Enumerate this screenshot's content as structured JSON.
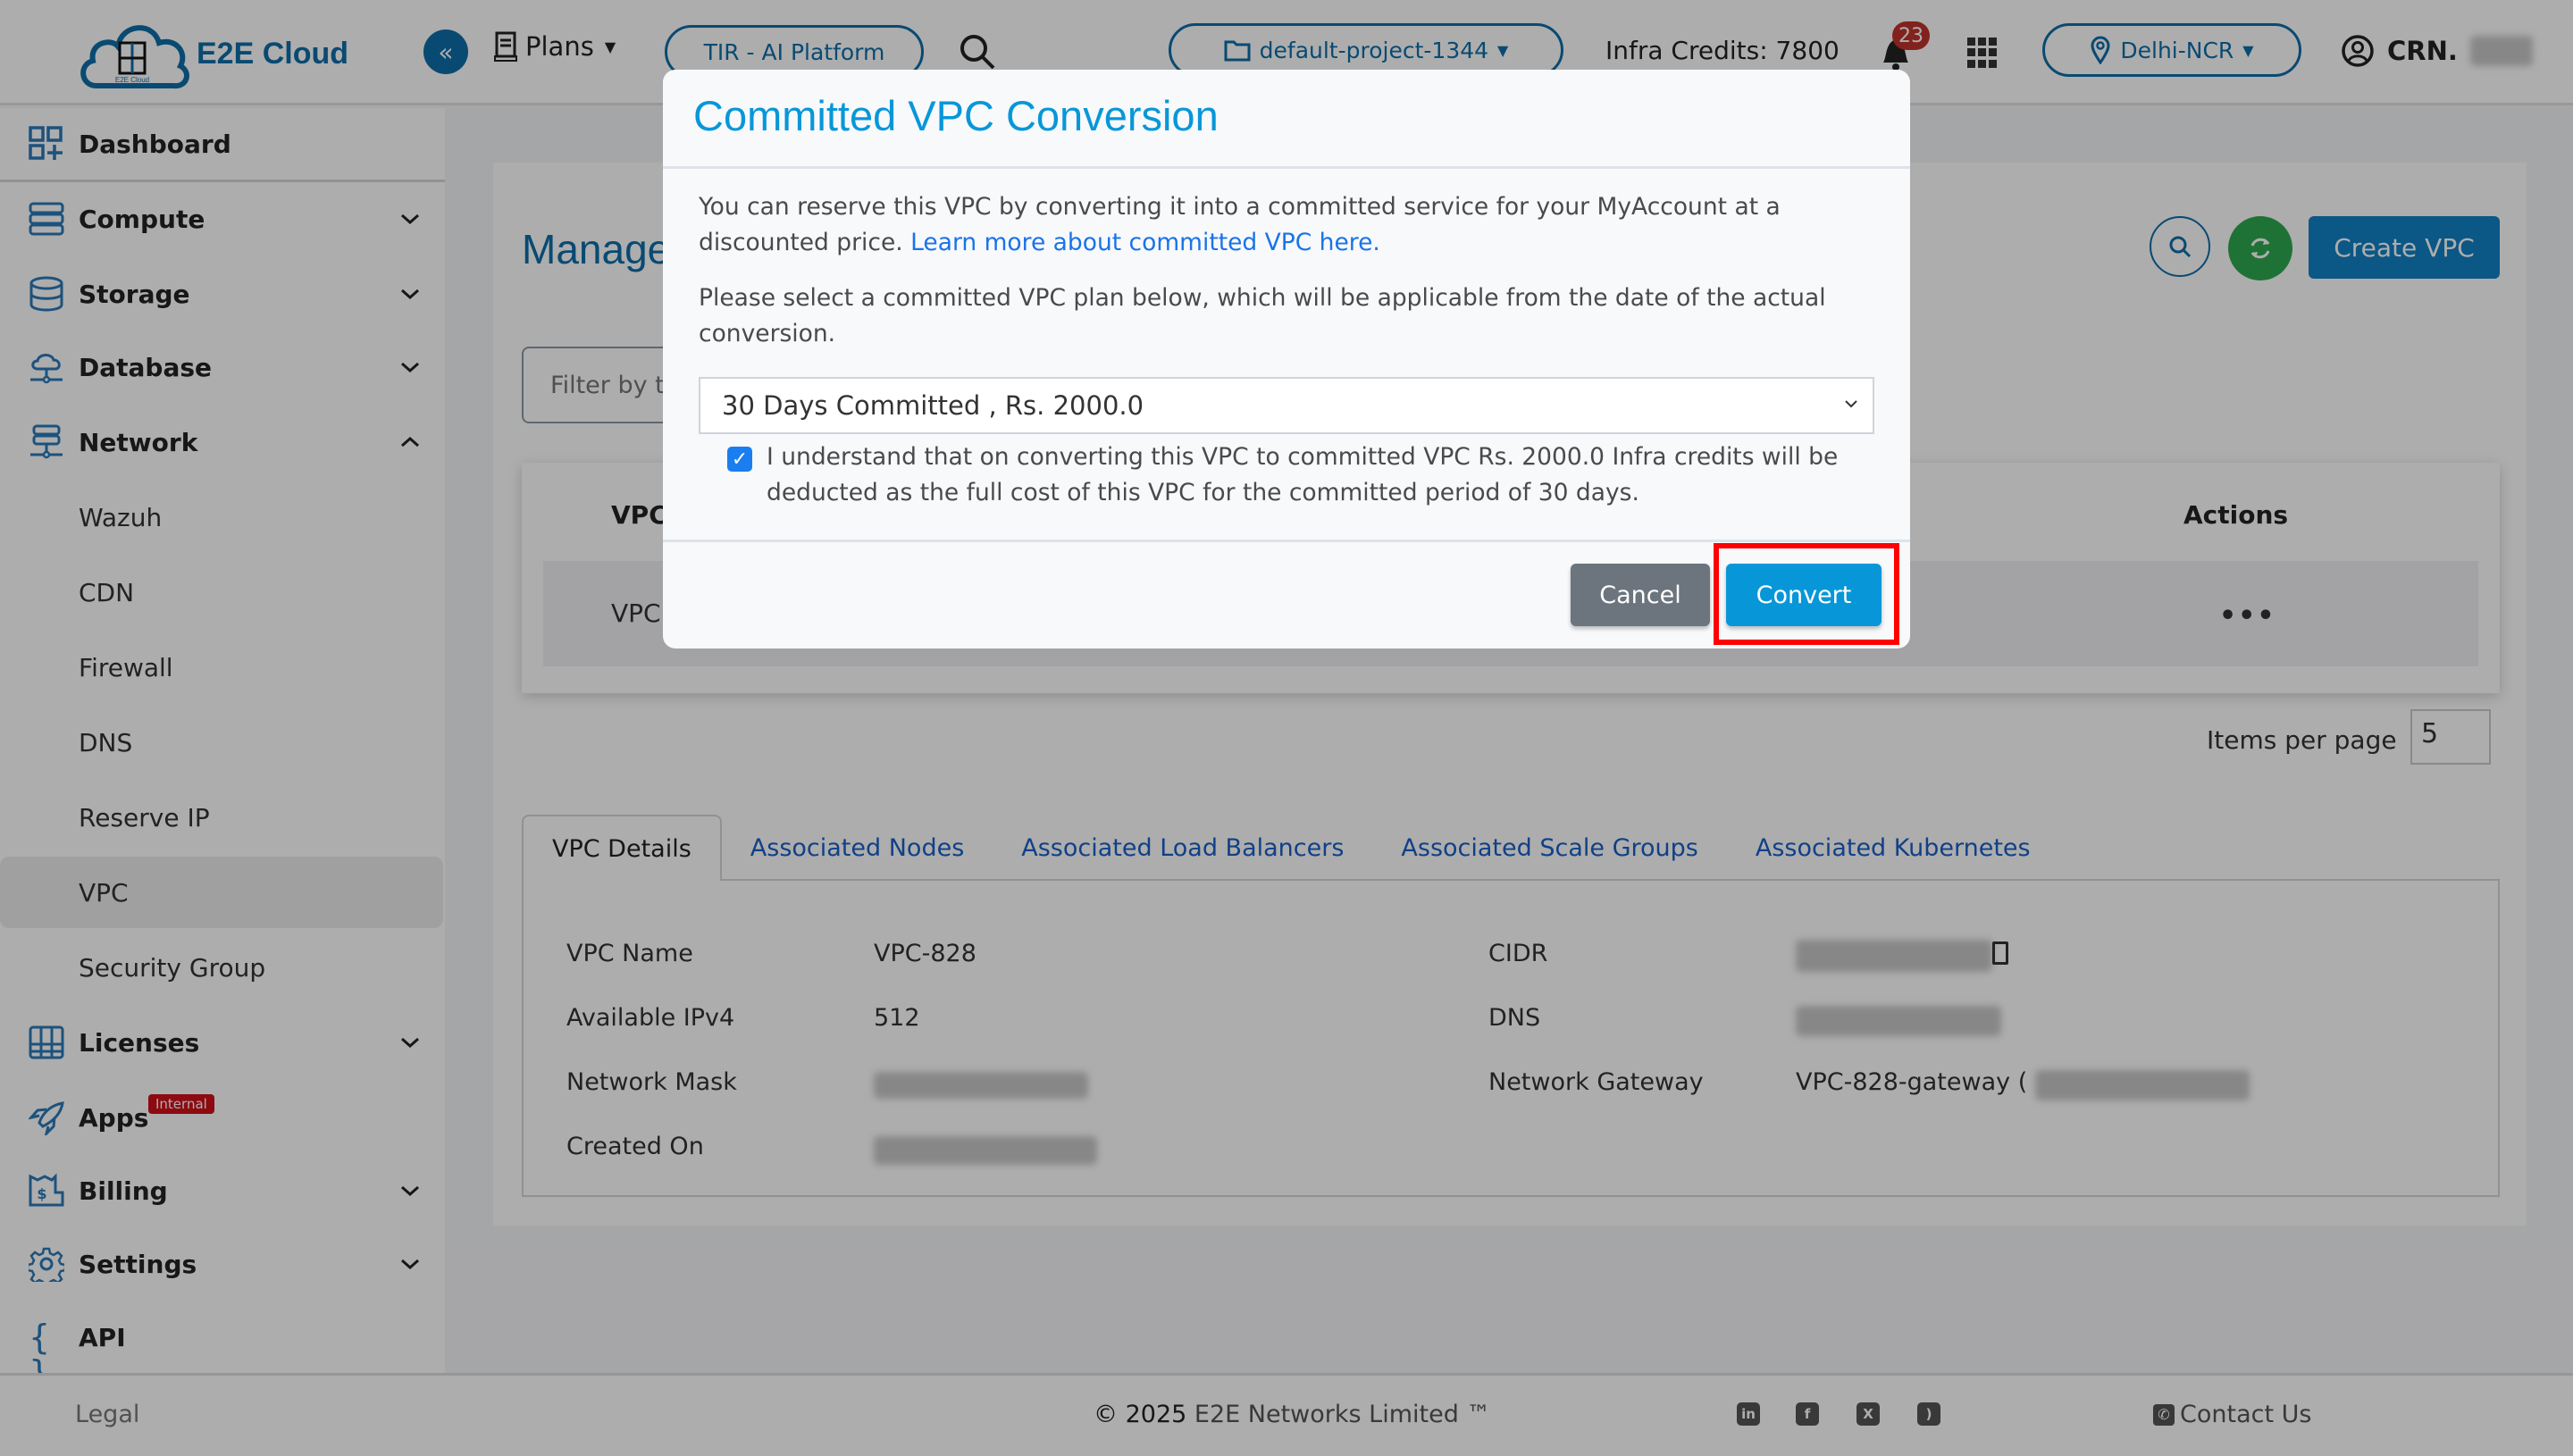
{
  "header": {
    "brand": "E2E Cloud",
    "logo_caption": "E2E Cloud",
    "plans_label": "Plans",
    "tir_label": "TIR - AI Platform",
    "project_label": "default-project-1344",
    "infra_credits": "Infra Credits: 7800",
    "notification_count": "23",
    "region_label": "Delhi-NCR",
    "user_label": "CRN."
  },
  "sidebar": {
    "items": [
      {
        "label": "Dashboard",
        "icon": "dashboard-icon",
        "expandable": false
      },
      {
        "label": "Compute",
        "icon": "server-icon",
        "expandable": true,
        "expanded": false
      },
      {
        "label": "Storage",
        "icon": "database-icon",
        "expandable": true,
        "expanded": false
      },
      {
        "label": "Database",
        "icon": "cloud-network-icon",
        "expandable": true,
        "expanded": false
      },
      {
        "label": "Network",
        "icon": "network-icon",
        "expandable": true,
        "expanded": true
      },
      {
        "label": "Licenses",
        "icon": "licenses-icon",
        "expandable": true,
        "expanded": false
      },
      {
        "label": "Apps",
        "icon": "rocket-icon",
        "badge": "Internal",
        "expandable": false
      },
      {
        "label": "Billing",
        "icon": "billing-icon",
        "expandable": true,
        "expanded": false
      },
      {
        "label": "Settings",
        "icon": "gear-icon",
        "expandable": true,
        "expanded": false
      },
      {
        "label": "API",
        "icon": "braces-icon",
        "expandable": false
      }
    ],
    "network_subitems": [
      {
        "label": "Wazuh",
        "active": false
      },
      {
        "label": "CDN",
        "active": false
      },
      {
        "label": "Firewall",
        "active": false
      },
      {
        "label": "DNS",
        "active": false
      },
      {
        "label": "Reserve IP",
        "active": false
      },
      {
        "label": "VPC",
        "active": true
      },
      {
        "label": "Security Group",
        "active": false
      }
    ]
  },
  "main": {
    "page_title": "Manage",
    "filter_placeholder": "Filter by t",
    "create_button": "Create VPC",
    "table": {
      "headers": [
        "VPC",
        "Actions"
      ],
      "rows": [
        {
          "name": "VPC",
          "actions": "•••"
        }
      ]
    },
    "items_per_page_label": "Items per page",
    "items_per_page_value": "5",
    "tabs": [
      {
        "label": "VPC Details",
        "active": true
      },
      {
        "label": "Associated Nodes",
        "active": false
      },
      {
        "label": "Associated Load Balancers",
        "active": false
      },
      {
        "label": "Associated Scale Groups",
        "active": false
      },
      {
        "label": "Associated Kubernetes",
        "active": false
      }
    ],
    "details": {
      "vpc_name_label": "VPC Name",
      "vpc_name": "VPC-828",
      "ipv4_label": "Available IPv4",
      "ipv4": "512",
      "mask_label": "Network Mask",
      "created_label": "Created On",
      "cidr_label": "CIDR",
      "dns_label": "DNS",
      "gateway_label": "Network Gateway",
      "gateway": "VPC-828-gateway ("
    }
  },
  "modal": {
    "title": "Committed VPC Conversion",
    "intro": "You can reserve this VPC by converting it into a committed service for your MyAccount at a discounted price. ",
    "learn_more": "Learn more about committed VPC here.",
    "select_prompt": "Please select a committed VPC plan below, which will be applicable from the date of the actual conversion.",
    "selected_plan": "30 Days Committed , Rs. 2000.0",
    "ack_checked": true,
    "ack_text": "I understand that on converting this VPC to committed VPC Rs. 2000.0 Infra credits will be deducted as the full cost of this VPC for the committed period of 30 days.",
    "cancel_label": "Cancel",
    "convert_label": "Convert"
  },
  "footer": {
    "legal": "Legal",
    "copyright_year": "© 2025",
    "copyright_company": "E2E Networks Limited ™",
    "social": [
      "linkedin-icon",
      "facebook-icon",
      "x-icon",
      "rss-icon"
    ],
    "contact": "Contact Us"
  },
  "colors": {
    "brand": "#0e6ea8",
    "modal_title": "#0797d9",
    "convert_button": "#0797d9",
    "cancel_button": "#6c757d",
    "refresh_button": "#2fa84f",
    "notification_badge": "#c0332b",
    "internal_badge": "#d0101a",
    "highlight": "#ff0000"
  }
}
